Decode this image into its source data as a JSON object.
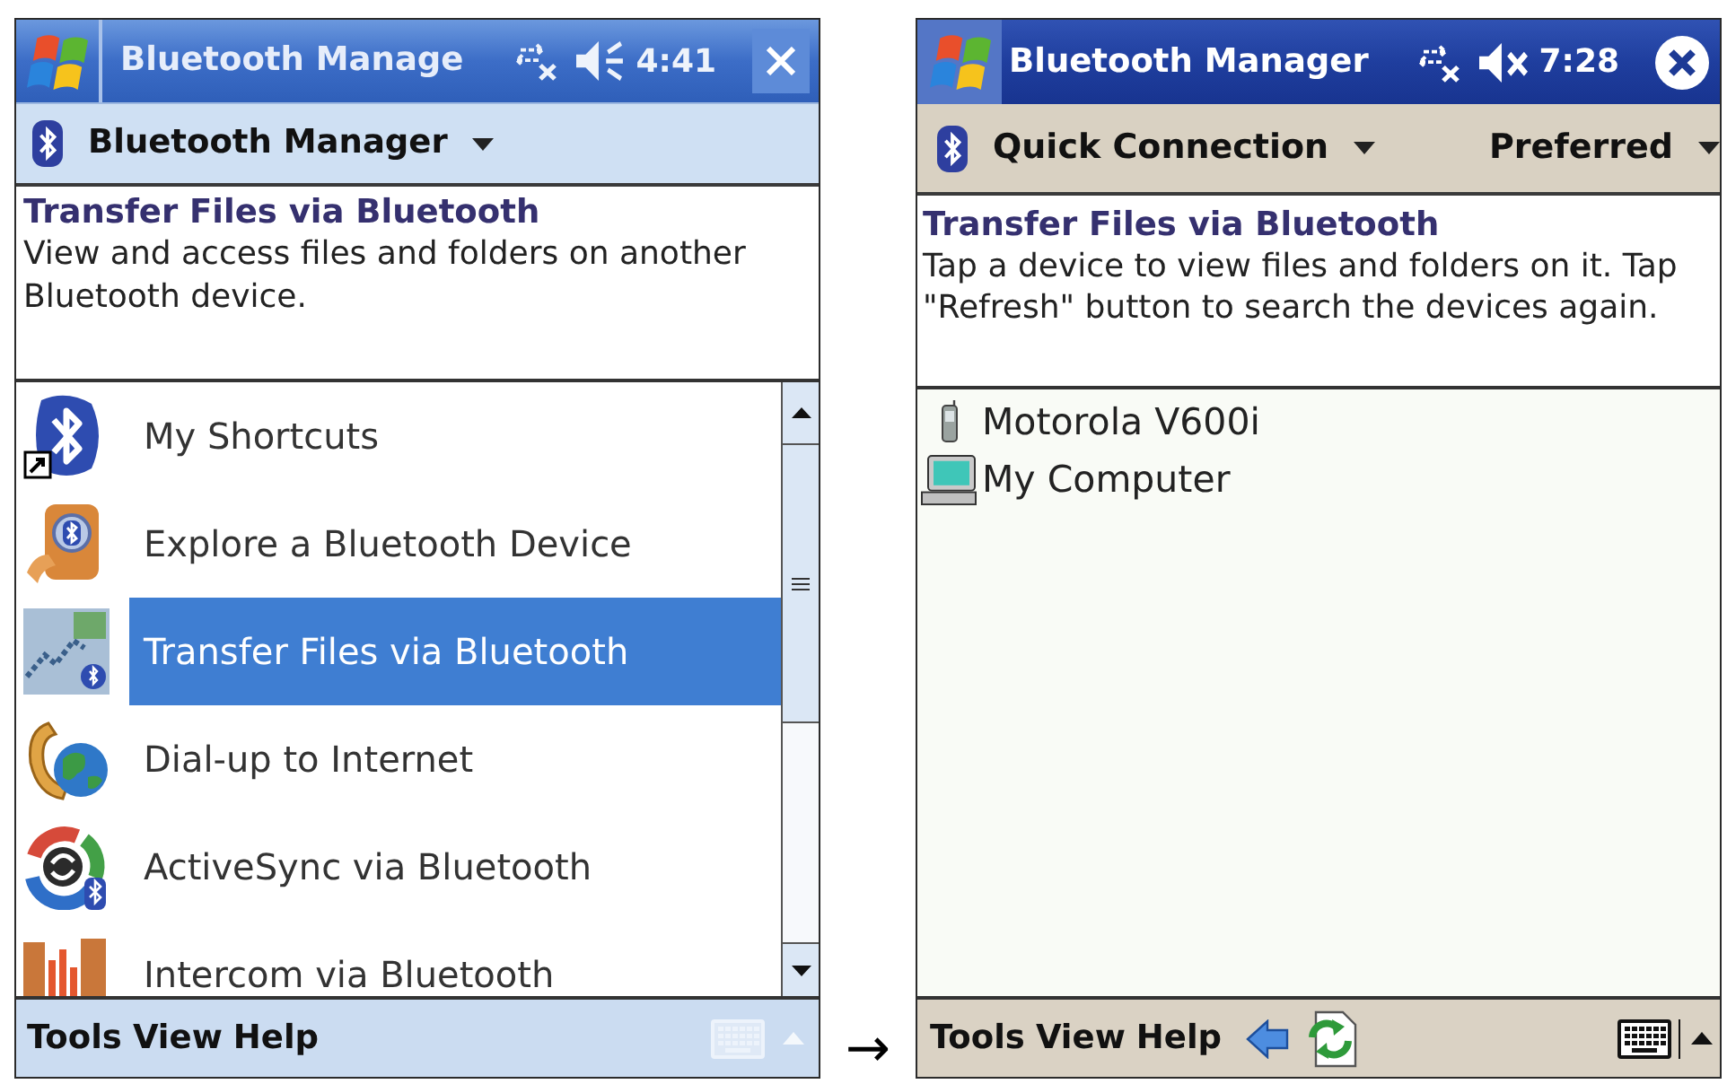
{
  "screens": [
    {
      "kind": "menu",
      "title_bar": {
        "title": "Bluetooth Manage",
        "muted": false,
        "time": "4:41"
      },
      "menus": [
        {
          "label": "Bluetooth Manager"
        }
      ],
      "header": {
        "title": "Transfer Files via Bluetooth",
        "text": "View and access files and folders on another Bluetooth device."
      },
      "items": [
        {
          "kind": "shortcuts",
          "label": "My Shortcuts",
          "selected": false
        },
        {
          "kind": "explore",
          "label": "Explore a Bluetooth Device",
          "selected": false
        },
        {
          "kind": "transfer",
          "label": "Transfer Files via Bluetooth",
          "selected": true
        },
        {
          "kind": "dialup",
          "label": "Dial-up to Internet",
          "selected": false
        },
        {
          "kind": "activesync",
          "label": "ActiveSync via Bluetooth",
          "selected": false
        },
        {
          "kind": "intercom",
          "label": "Intercom via Bluetooth",
          "selected": false
        }
      ],
      "menu_bar": {
        "menus": [
          "Tools",
          "View",
          "Help"
        ],
        "keyboard": {
          "disabled": true
        }
      }
    },
    {
      "kind": "devices",
      "title_bar": {
        "title": "Bluetooth Manager",
        "muted": true,
        "time": "7:28"
      },
      "menus": [
        {
          "label": "Quick Connection"
        },
        {
          "label": "Preferred"
        }
      ],
      "header": {
        "title": "Transfer Files via Bluetooth",
        "text": "Tap a device to view files and folders on it. Tap \"Refresh\" button to search the devices again."
      },
      "items": [
        {
          "kind": "phone",
          "label": "Motorola V600i",
          "selected": false
        },
        {
          "kind": "computer",
          "label": "My Computer",
          "selected": false
        }
      ],
      "menu_bar": {
        "menus": [
          "Tools",
          "View",
          "Help"
        ],
        "tools": [
          {
            "kind": "back"
          },
          {
            "kind": "refresh"
          }
        ],
        "keyboard": {
          "disabled": false
        }
      }
    }
  ],
  "connector": "→"
}
